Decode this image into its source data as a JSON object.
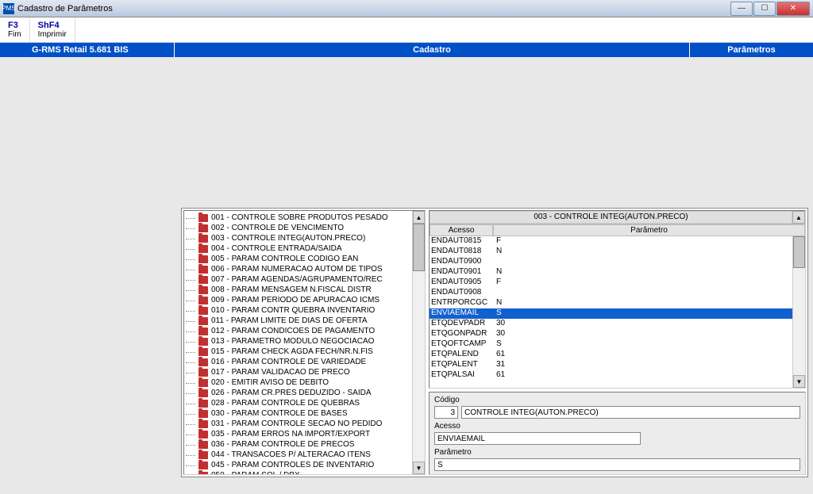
{
  "window": {
    "title": "Cadastro de Parâmetros",
    "icon_text": "PMS"
  },
  "shortcuts": [
    {
      "key": "F3",
      "label": "Fim"
    },
    {
      "key": "ShF4",
      "label": "Imprimir"
    }
  ],
  "bluebar": {
    "left": "G-RMS Retail 5.681 BIS",
    "middle": "Cadastro",
    "right": "Parâmetros"
  },
  "tree": [
    "001 - CONTROLE SOBRE PRODUTOS PESADO",
    "002 - CONTROLE DE VENCIMENTO",
    "003 - CONTROLE INTEG(AUTON.PRECO)",
    "004 - CONTROLE ENTRADA/SAIDA",
    "005 - PARAM CONTROLE CODIGO EAN",
    "006 - PARAM NUMERACAO AUTOM DE TIPOS",
    "007 - PARAM AGENDAS/AGRUPAMENTO/REC",
    "008 - PARAM MENSAGEM N.FISCAL DISTR",
    "009 - PARAM PERIODO DE APURACAO ICMS",
    "010 - PARAM CONTR QUEBRA INVENTARIO",
    "011 - PARAM LIMITE DE DIAS DE OFERTA",
    "012 - PARAM CONDICOES DE PAGAMENTO",
    "013 - PARAMETRO MODULO NEGOCIACAO",
    "015 - PARAM CHECK AGDA FECH/NR.N.FIS",
    "016 - PARAM CONTROLE DE VARIEDADE",
    "017 - PARAM VALIDACAO DE PRECO",
    "020 - EMITIR AVISO DE DEBITO",
    "026 - PARAM CR.PRES DEDUZIDO - SAIDA",
    "028 - PARAM CONTROLE DE QUEBRAS",
    "030 - PARAM CONTROLE DE BASES",
    "031 - PARAM CONTROLE SECAO NO PEDIDO",
    "035 - PARAM ERROS NA IMPORT/EXPORT",
    "036 - PARAM CONTROLE DE PRECOS",
    "044 - TRANSACOES P/ ALTERACAO ITENS",
    "045 - PARAM CONTROLES DE INVENTARIO",
    "050 - PARAM SQL / DBX"
  ],
  "grid": {
    "title": "003 - CONTROLE INTEG(AUTON.PRECO)",
    "header_acesso": "Acesso",
    "header_param": "Parâmetro",
    "rows": [
      {
        "acesso": "ENDAUT0815",
        "param": "F",
        "selected": false
      },
      {
        "acesso": "ENDAUT0818",
        "param": "N",
        "selected": false
      },
      {
        "acesso": "ENDAUT0900",
        "param": "",
        "selected": false
      },
      {
        "acesso": "ENDAUT0901",
        "param": "N",
        "selected": false
      },
      {
        "acesso": "ENDAUT0905",
        "param": "F",
        "selected": false
      },
      {
        "acesso": "ENDAUT0908",
        "param": "",
        "selected": false
      },
      {
        "acesso": "ENTRPORCGC",
        "param": "N",
        "selected": false
      },
      {
        "acesso": "ENVIAEMAIL",
        "param": "S",
        "selected": true
      },
      {
        "acesso": "ETQDEVPADR",
        "param": "30",
        "selected": false
      },
      {
        "acesso": "ETQGONPADR",
        "param": "30",
        "selected": false
      },
      {
        "acesso": "ETQOFTCAMP",
        "param": "S",
        "selected": false
      },
      {
        "acesso": "ETQPALEND",
        "param": "61",
        "selected": false
      },
      {
        "acesso": "ETQPALENT",
        "param": "31",
        "selected": false
      },
      {
        "acesso": "ETQPALSAI",
        "param": "61",
        "selected": false
      }
    ]
  },
  "detail": {
    "label_codigo": "Código",
    "codigo_num": "3",
    "codigo_desc": "CONTROLE INTEG(AUTON.PRECO)",
    "label_acesso": "Acesso",
    "acesso_value": "ENVIAEMAIL",
    "label_param": "Parâmetro",
    "param_value": "S"
  }
}
